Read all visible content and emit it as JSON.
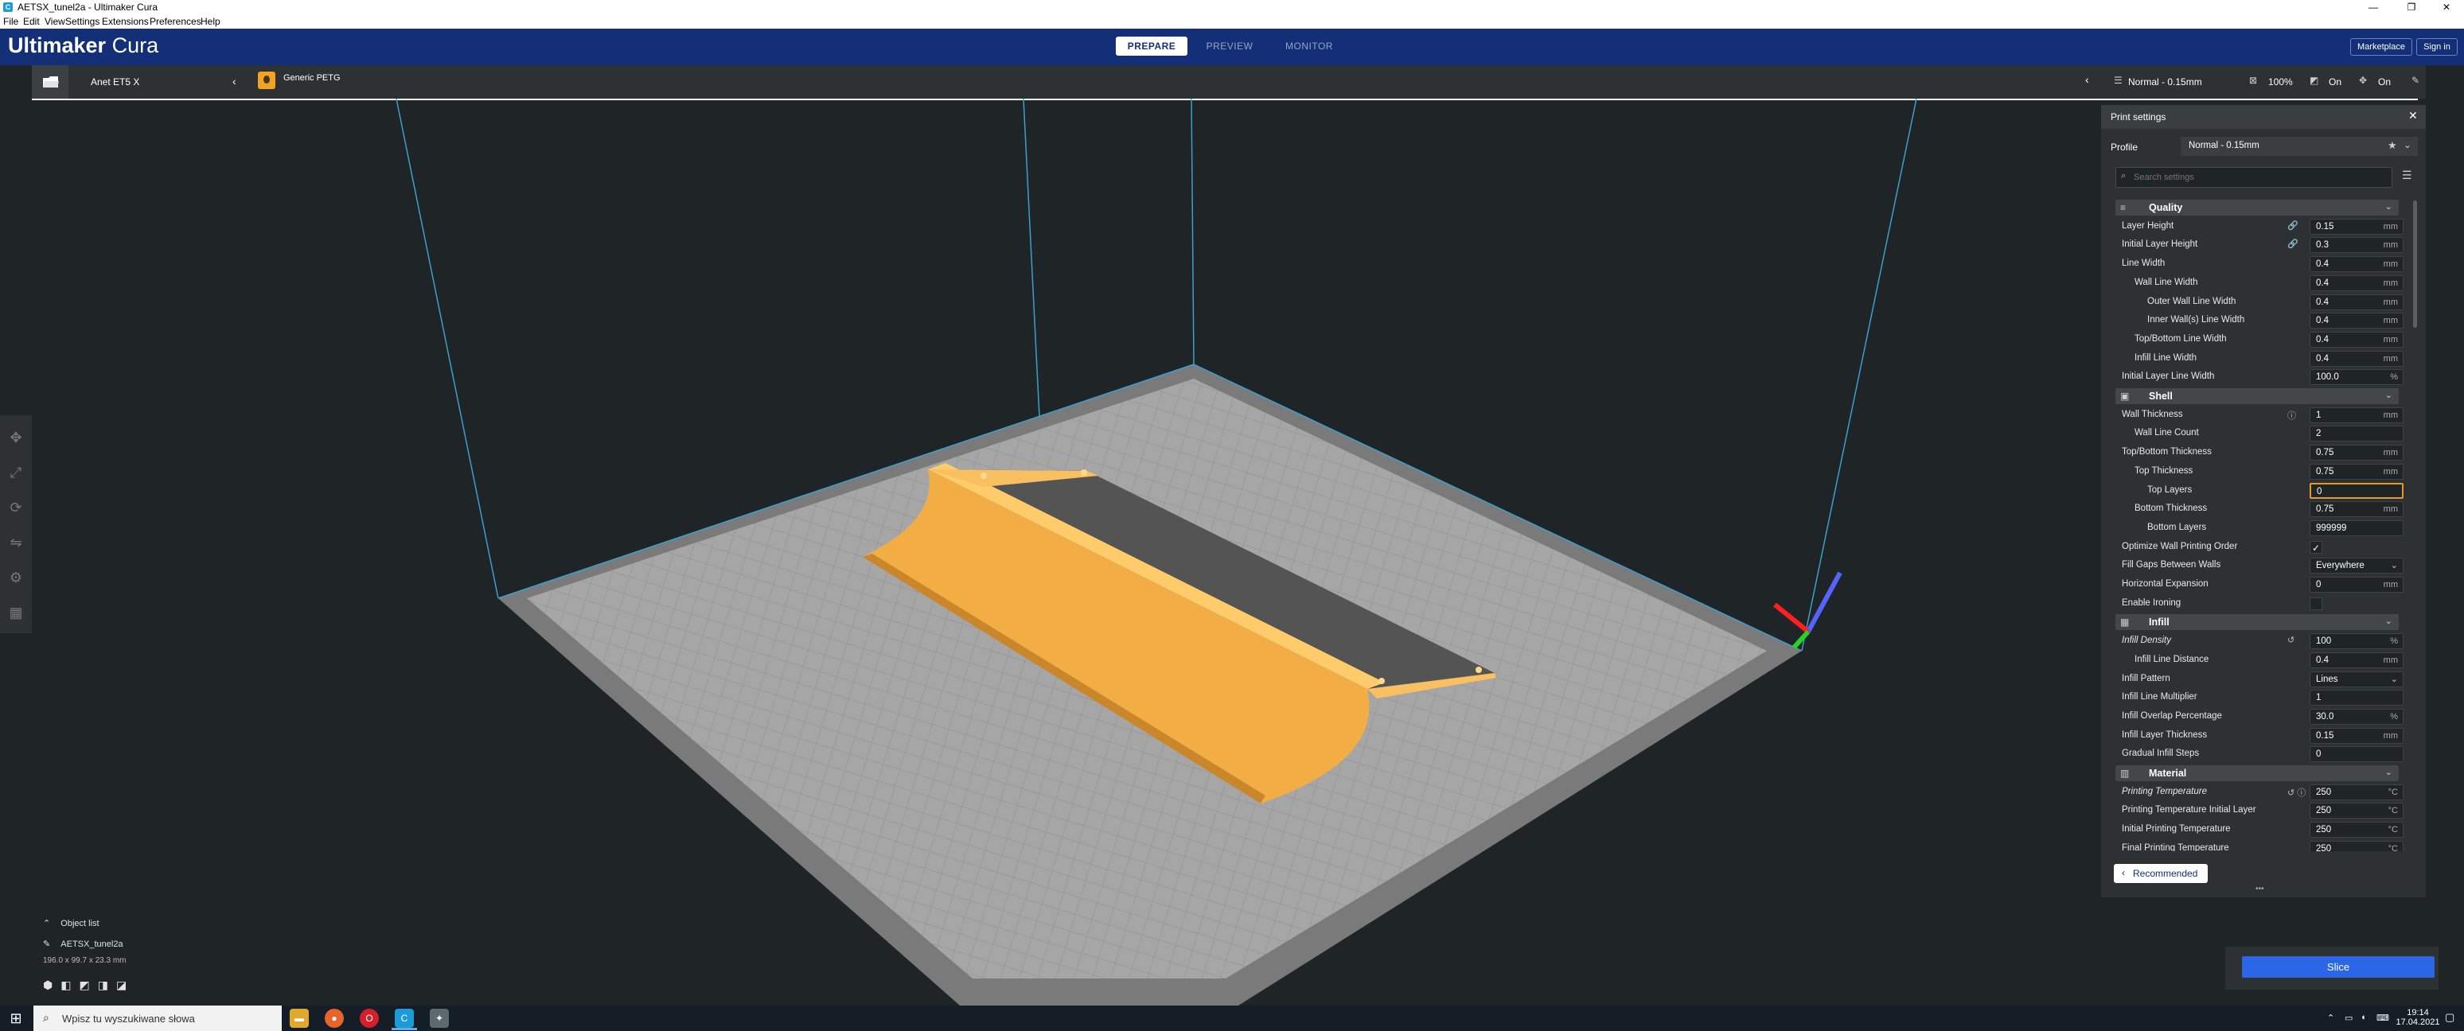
{
  "window": {
    "title": "AETSX_tunel2a - Ultimaker Cura",
    "icon": "C",
    "controls": [
      "—",
      "❐",
      "✕"
    ]
  },
  "menu": [
    "File",
    "Edit",
    "View",
    "Settings",
    "Extensions",
    "Preferences",
    "Help"
  ],
  "header": {
    "logo_bold": "Ultimaker",
    "logo_light": " Cura",
    "tabs": [
      "PREPARE",
      "PREVIEW",
      "MONITOR"
    ],
    "marketplace": "Marketplace",
    "signin": "Sign in"
  },
  "actionbar": {
    "printer": "Anet ET5 X",
    "material": "Generic PETG",
    "profile_summary": "Normal - 0.15mm",
    "infill_summary": "100%",
    "support_summary": "On",
    "adhesion_summary": "On"
  },
  "print_settings": {
    "title": "Print settings",
    "profile_label": "Profile",
    "profile_value": "Normal - 0.15mm",
    "search_placeholder": "Search settings",
    "rows": [
      {
        "kind": "cat",
        "label": "Quality",
        "icon": "≡"
      },
      {
        "kind": "row",
        "label": "Layer Height",
        "indent": 0,
        "value": "0.15",
        "unit": "mm",
        "icon": "🔗"
      },
      {
        "kind": "row",
        "label": "Initial Layer Height",
        "indent": 0,
        "value": "0.3",
        "unit": "mm",
        "icon": "🔗"
      },
      {
        "kind": "row",
        "label": "Line Width",
        "indent": 0,
        "value": "0.4",
        "unit": "mm"
      },
      {
        "kind": "row",
        "label": "Wall Line Width",
        "indent": 1,
        "value": "0.4",
        "unit": "mm"
      },
      {
        "kind": "row",
        "label": "Outer Wall Line Width",
        "indent": 2,
        "value": "0.4",
        "unit": "mm"
      },
      {
        "kind": "row",
        "label": "Inner Wall(s) Line Width",
        "indent": 2,
        "value": "0.4",
        "unit": "mm"
      },
      {
        "kind": "row",
        "label": "Top/Bottom Line Width",
        "indent": 1,
        "value": "0.4",
        "unit": "mm"
      },
      {
        "kind": "row",
        "label": "Infill Line Width",
        "indent": 1,
        "value": "0.4",
        "unit": "mm"
      },
      {
        "kind": "row",
        "label": "Initial Layer Line Width",
        "indent": 0,
        "value": "100.0",
        "unit": "%"
      },
      {
        "kind": "cat",
        "label": "Shell",
        "icon": "▣"
      },
      {
        "kind": "row",
        "label": "Wall Thickness",
        "indent": 0,
        "value": "1",
        "unit": "mm",
        "icon": "ⓘ"
      },
      {
        "kind": "row",
        "label": "Wall Line Count",
        "indent": 1,
        "value": "2",
        "unit": ""
      },
      {
        "kind": "row",
        "label": "Top/Bottom Thickness",
        "indent": 0,
        "value": "0.75",
        "unit": "mm"
      },
      {
        "kind": "row",
        "label": "Top Thickness",
        "indent": 1,
        "value": "0.75",
        "unit": "mm"
      },
      {
        "kind": "row",
        "label": "Top Layers",
        "indent": 2,
        "value": "0",
        "unit": "",
        "active": true
      },
      {
        "kind": "row",
        "label": "Bottom Thickness",
        "indent": 1,
        "value": "0.75",
        "unit": "mm"
      },
      {
        "kind": "row",
        "label": "Bottom Layers",
        "indent": 2,
        "value": "999999",
        "unit": ""
      },
      {
        "kind": "check",
        "label": "Optimize Wall Printing Order",
        "indent": 0,
        "checked": true
      },
      {
        "kind": "select",
        "label": "Fill Gaps Between Walls",
        "indent": 0,
        "value": "Everywhere"
      },
      {
        "kind": "row",
        "label": "Horizontal Expansion",
        "indent": 0,
        "value": "0",
        "unit": "mm"
      },
      {
        "kind": "check",
        "label": "Enable Ironing",
        "indent": 0,
        "checked": false
      },
      {
        "kind": "cat",
        "label": "Infill",
        "icon": "▦"
      },
      {
        "kind": "row",
        "label": "Infill Density",
        "indent": 0,
        "value": "100",
        "unit": "%",
        "icon": "↺",
        "italic": true
      },
      {
        "kind": "row",
        "label": "Infill Line Distance",
        "indent": 1,
        "value": "0.4",
        "unit": "mm"
      },
      {
        "kind": "select",
        "label": "Infill Pattern",
        "indent": 0,
        "value": "Lines"
      },
      {
        "kind": "row",
        "label": "Infill Line Multiplier",
        "indent": 0,
        "value": "1",
        "unit": ""
      },
      {
        "kind": "row",
        "label": "Infill Overlap Percentage",
        "indent": 0,
        "value": "30.0",
        "unit": "%"
      },
      {
        "kind": "row",
        "label": "Infill Layer Thickness",
        "indent": 0,
        "value": "0.15",
        "unit": "mm"
      },
      {
        "kind": "row",
        "label": "Gradual Infill Steps",
        "indent": 0,
        "value": "0",
        "unit": ""
      },
      {
        "kind": "cat",
        "label": "Material",
        "icon": "▥"
      },
      {
        "kind": "row",
        "label": "Printing Temperature",
        "indent": 0,
        "value": "250",
        "unit": "°C",
        "icon": "↺ ⓘ",
        "italic": true
      },
      {
        "kind": "row",
        "label": "Printing Temperature Initial Layer",
        "indent": 0,
        "value": "250",
        "unit": "°C"
      },
      {
        "kind": "row",
        "label": "Initial Printing Temperature",
        "indent": 0,
        "value": "250",
        "unit": "°C"
      },
      {
        "kind": "row",
        "label": "Final Printing Temperature",
        "indent": 0,
        "value": "250",
        "unit": "°C"
      }
    ],
    "recommended_label": "Recommended"
  },
  "object_list": {
    "toggle_label": "Object list",
    "object_name": "AETSX_tunel2a",
    "dimensions": "196.0 x 99.7 x 23.3 mm"
  },
  "slice_label": "Slice",
  "taskbar": {
    "search_placeholder": "Wpisz tu wyszukiwane słowa",
    "time": "19:14",
    "date": "17.04.2021"
  },
  "colors": {
    "header": "#122f77",
    "panel": "#2d3133",
    "viewport": "#1f2426",
    "model": "#f5b451",
    "accent": "#2b66e6"
  }
}
